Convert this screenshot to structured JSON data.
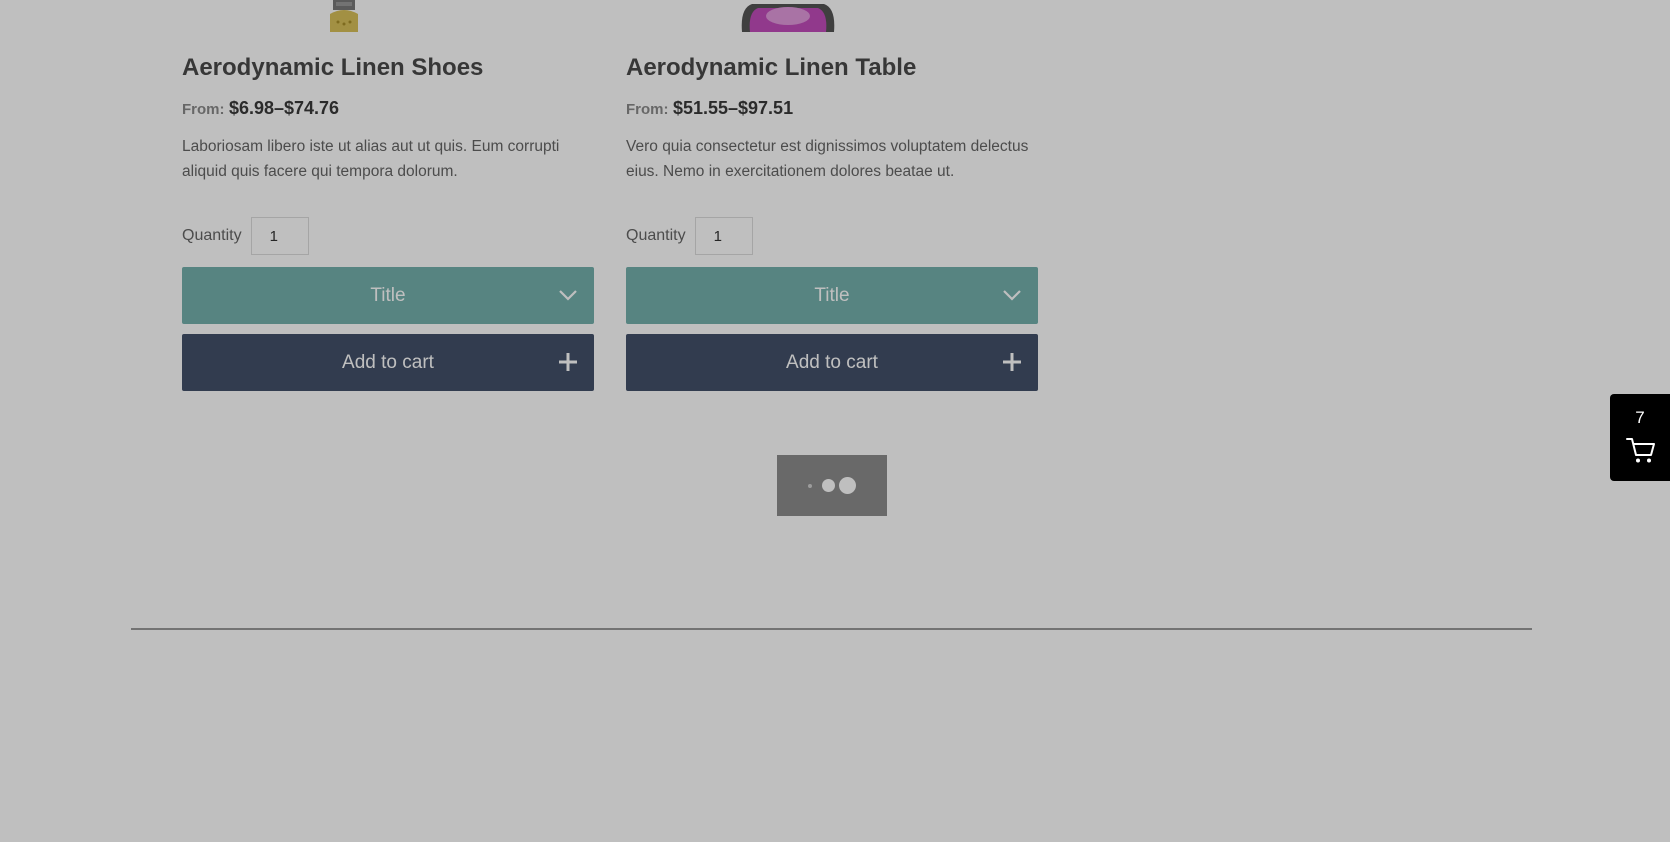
{
  "products": [
    {
      "title": "Aerodynamic Linen Shoes",
      "price_prefix": "From:",
      "price_range": "$6.98–$74.76",
      "description": "Laboriosam libero iste ut alias aut ut quis. Eum corrupti aliquid quis facere qui tempora dolorum.",
      "quantity_label": "Quantity",
      "quantity_value": "1",
      "variant_select_label": "Title",
      "add_to_cart_label": "Add to cart"
    },
    {
      "title": "Aerodynamic Linen Table",
      "price_prefix": "From:",
      "price_range": "$51.55–$97.51",
      "description": "Vero quia consectetur est dignissimos voluptatem delectus eius. Nemo in exercitationem dolores beatae ut.",
      "quantity_label": "Quantity",
      "quantity_value": "1",
      "variant_select_label": "Title",
      "add_to_cart_label": "Add to cart"
    }
  ],
  "cart": {
    "count": "7",
    "icon": "cart-icon"
  },
  "colors": {
    "variant_select": "#75b1ad",
    "add_to_cart": "#43516a",
    "overlay": "rgba(0,0,0,0.25)",
    "cart_toggle": "#000000"
  },
  "icons": {
    "select": "chevron-down-icon",
    "add": "plus-icon",
    "loading": "loading-dots-icon"
  }
}
